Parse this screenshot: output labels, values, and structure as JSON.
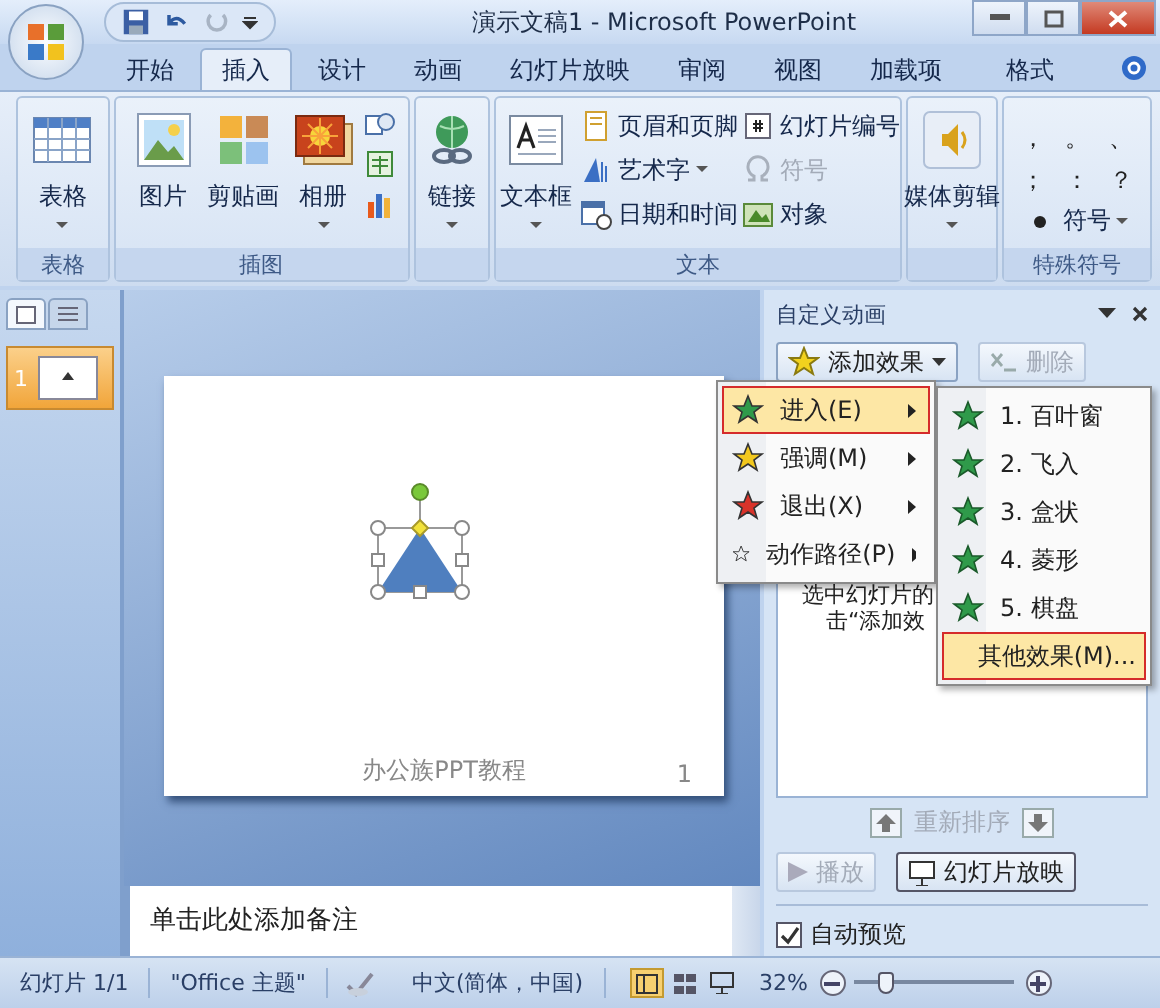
{
  "window": {
    "title": "演示文稿1 - Microsoft PowerPoint"
  },
  "tabs": [
    {
      "label": "开始",
      "selected": false,
      "kind": "normal"
    },
    {
      "label": "插入",
      "selected": true,
      "kind": "normal"
    },
    {
      "label": "设计",
      "selected": false,
      "kind": "normal"
    },
    {
      "label": "动画",
      "selected": false,
      "kind": "normal"
    },
    {
      "label": "幻灯片放映",
      "selected": false,
      "kind": "normal"
    },
    {
      "label": "审阅",
      "selected": false,
      "kind": "normal"
    },
    {
      "label": "视图",
      "selected": false,
      "kind": "normal"
    },
    {
      "label": "加载项",
      "selected": false,
      "kind": "normal"
    },
    {
      "label": "格式",
      "selected": false,
      "kind": "contextual"
    }
  ],
  "ribbon": {
    "groups": [
      {
        "label": "表格",
        "items": [
          {
            "kind": "large",
            "label": "表格",
            "dropdown": true
          }
        ]
      },
      {
        "label": "插图",
        "items": [
          {
            "kind": "large",
            "label": "图片",
            "dropdown": false
          },
          {
            "kind": "large",
            "label": "剪贴画",
            "dropdown": false
          },
          {
            "kind": "large",
            "label": "相册",
            "dropdown": true
          },
          {
            "kind": "icon_stack"
          }
        ]
      },
      {
        "items": [
          {
            "kind": "large",
            "label": "链接",
            "dropdown": true
          }
        ]
      },
      {
        "label": "文本",
        "items": [
          {
            "kind": "large",
            "label": "文本框",
            "dropdown": true
          },
          {
            "kind": "column",
            "items": [
              {
                "label": "页眉和页脚",
                "dropdown": false,
                "disabled": false
              },
              {
                "label": "艺术字",
                "dropdown": true,
                "disabled": false
              },
              {
                "label": "日期和时间",
                "dropdown": false,
                "disabled": false
              }
            ]
          },
          {
            "kind": "column",
            "items": [
              {
                "label": "幻灯片编号",
                "dropdown": false,
                "disabled": false
              },
              {
                "label": "符号",
                "dropdown": false,
                "disabled": true
              },
              {
                "label": "对象",
                "dropdown": false,
                "disabled": false
              }
            ]
          }
        ]
      },
      {
        "items": [
          {
            "kind": "large",
            "label": "媒体剪辑",
            "dropdown": true
          }
        ]
      },
      {
        "label": "特殊符号",
        "items": [
          {
            "kind": "symbols",
            "symbols": [
              "，",
              "。",
              "、",
              "；",
              "：",
              "？"
            ]
          },
          {
            "kind": "small",
            "label": "符号",
            "dropdown": true
          }
        ]
      }
    ]
  },
  "slide_panel": {
    "tabs": [
      {
        "selected": true
      },
      {
        "selected": false
      }
    ],
    "thumbnails": [
      {
        "number": "1",
        "selected": true
      }
    ]
  },
  "slide": {
    "footer": "办公族PPT教程",
    "number": "1"
  },
  "notes": {
    "placeholder": "单击此处添加备注"
  },
  "task_pane": {
    "title": "自定义动画",
    "add_button": "添加效果",
    "remove_button": {
      "label": "删除",
      "disabled": true
    },
    "hint_lines": [
      "选中幻灯片的",
      "击“添加效"
    ],
    "reorder_label": "重新排序",
    "play_button": {
      "label": "播放",
      "disabled": true
    },
    "slideshow_button": "幻灯片放映",
    "autopreview": {
      "label": "自动预览",
      "checked": true
    }
  },
  "effect_menu": {
    "items": [
      {
        "label": "进入(E)",
        "selected": true
      },
      {
        "label": "强调(M)",
        "selected": false
      },
      {
        "label": "退出(X)",
        "selected": false
      },
      {
        "label": "动作路径(P)",
        "selected": false
      }
    ]
  },
  "entrance_submenu": {
    "items": [
      {
        "label": "1. 百叶窗",
        "selected": false
      },
      {
        "label": "2. 飞入",
        "selected": false
      },
      {
        "label": "3. 盒状",
        "selected": false
      },
      {
        "label": "4. 菱形",
        "selected": false
      },
      {
        "label": "5. 棋盘",
        "selected": false
      },
      {
        "label": "其他效果(M)...",
        "selected": true
      }
    ]
  },
  "status_bar": {
    "slide": "幻灯片 1/1",
    "theme": "\"Office 主题\"",
    "language": "中文(简体，中国)",
    "zoom": "32%",
    "zoom_slider": {
      "level": 0.2
    }
  }
}
